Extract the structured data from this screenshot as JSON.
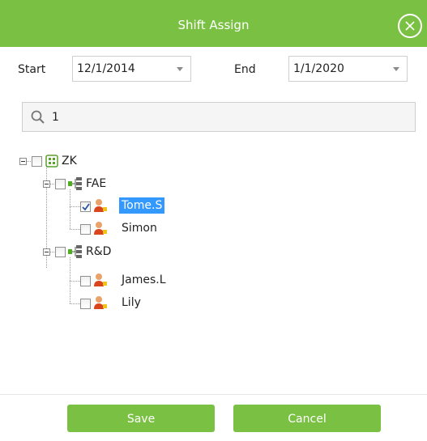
{
  "dialog": {
    "title": "Shift Assign"
  },
  "dates": {
    "start_label": "Start",
    "start_value": "12/1/2014",
    "end_label": "End",
    "end_value": "1/1/2020"
  },
  "search": {
    "value": "1",
    "placeholder": ""
  },
  "tree": {
    "root": {
      "label": "ZK",
      "checked": false
    },
    "groups": [
      {
        "label": "FAE",
        "checked": false,
        "members": [
          {
            "label": "Tome.S",
            "checked": true,
            "selected": true
          },
          {
            "label": "Simon",
            "checked": false,
            "selected": false
          }
        ]
      },
      {
        "label": "R&D",
        "checked": false,
        "members": [
          {
            "label": "James.L",
            "checked": false,
            "selected": false
          },
          {
            "label": "Lily",
            "checked": false,
            "selected": false
          }
        ]
      }
    ]
  },
  "footer": {
    "save_label": "Save",
    "cancel_label": "Cancel"
  },
  "colors": {
    "accent": "#7ac143",
    "selection": "#3399ff"
  },
  "icons": {
    "close": "close-circle-icon",
    "dropdown": "caret-down-icon",
    "search": "search-icon",
    "company": "company-icon",
    "department": "department-icon",
    "person": "person-icon",
    "check": "check-icon"
  }
}
